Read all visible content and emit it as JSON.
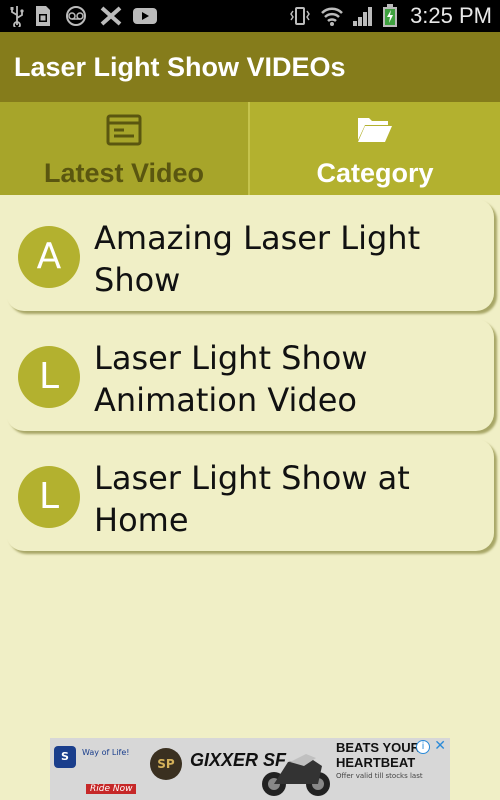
{
  "status_bar": {
    "time": "3:25 PM",
    "left_icons": [
      "usb-icon",
      "sim-card-icon",
      "voicemail-icon",
      "x-icon",
      "youtube-icon"
    ],
    "right_icons": [
      "vibrate-icon",
      "wifi-icon",
      "signal-icon",
      "battery-charging-icon"
    ]
  },
  "app_bar": {
    "title": "Laser Light Show VIDEOs",
    "color": "#857c1b"
  },
  "tabs": [
    {
      "label": "Latest Video",
      "icon": "list-icon",
      "active": true
    },
    {
      "label": "Category",
      "icon": "folder-icon",
      "active": false
    }
  ],
  "list": {
    "items": [
      {
        "letter": "A",
        "title": "Amazing Laser Light Show"
      },
      {
        "letter": "L",
        "title": "Laser Light Show Animation Video"
      },
      {
        "letter": "L",
        "title": "Laser Light Show at Home"
      }
    ]
  },
  "ad": {
    "brand_logo": "S",
    "brand_text": "Way of Life!",
    "badge": "SP",
    "model": "GIXXER SF",
    "headline": "BEATS YOUR HEARTBEAT",
    "subtext": "Offer valid till stocks last",
    "cta": "Ride Now",
    "info_glyph": "i",
    "close_glyph": "✕"
  },
  "colors": {
    "background": "#f0efc6",
    "accent": "#b3b12f",
    "dark_accent": "#857c1b",
    "active_tab_text": "#5a5610"
  }
}
